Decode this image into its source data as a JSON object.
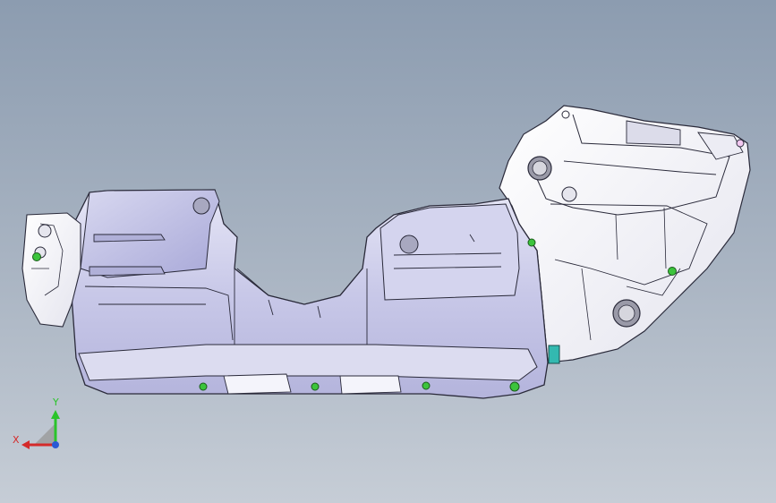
{
  "viewport": {
    "background_top": "#8c9cb0",
    "background_bottom": "#c6cdd6",
    "model_face_color": "#f4f4fb",
    "model_shade_color": "#c9c9e6",
    "edge_color": "#2a2a3a",
    "fastener_color": "#3cc43c",
    "clip_color": "#33b9b0"
  },
  "triad": {
    "x_label": "X",
    "y_label": "Y",
    "x_color": "#d42a2a",
    "y_color": "#2ac42a",
    "z_color": "#2a5ad4"
  }
}
